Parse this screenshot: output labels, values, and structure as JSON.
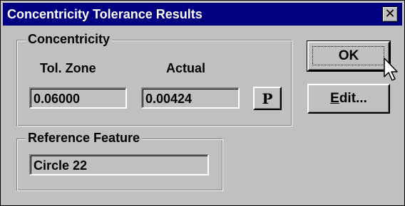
{
  "window": {
    "title": "Concentricity Tolerance Results"
  },
  "concentricity": {
    "legend": "Concentricity",
    "tol_zone_label": "Tol. Zone",
    "actual_label": "Actual",
    "tol_zone_value": "0.06000",
    "actual_value": "0.00424",
    "p_button_label": "P"
  },
  "reference": {
    "legend": "Reference Feature",
    "value": "Circle 22"
  },
  "buttons": {
    "ok_label": "OK",
    "edit_label_mnemonic": "E",
    "edit_label_rest": "dit..."
  },
  "icons": {
    "close": "close-icon",
    "cursor": "mouse-pointer-icon"
  },
  "colors": {
    "titlebar": "#000080",
    "face": "#c0c0c0"
  }
}
